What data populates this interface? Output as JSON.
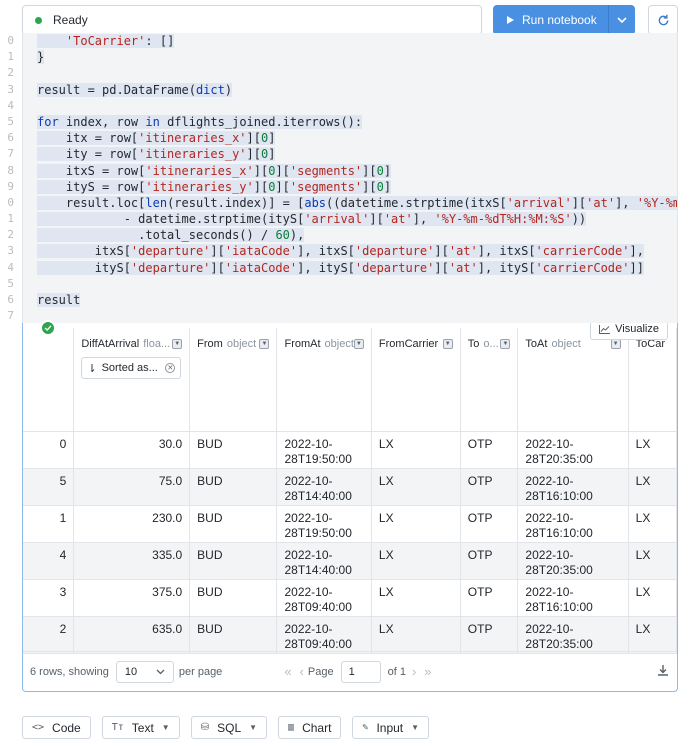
{
  "status": {
    "label": "Ready"
  },
  "run_button": {
    "label": "Run notebook"
  },
  "code": {
    "line_numbers": [
      "0",
      "1",
      "2",
      "3",
      "4",
      "5",
      "6",
      "7",
      "8",
      "9",
      "0",
      "1",
      "2",
      "3",
      "4",
      "5",
      "6",
      "7"
    ]
  },
  "output": {
    "visualize_label": "Visualize",
    "columns": [
      {
        "name": "",
        "type": ""
      },
      {
        "name": "DiffAtArrival",
        "type": "floa..."
      },
      {
        "name": "From",
        "type": "object"
      },
      {
        "name": "FromAt",
        "type": "object"
      },
      {
        "name": "FromCarrier",
        "type": ""
      },
      {
        "name": "To",
        "type": "o..."
      },
      {
        "name": "ToAt",
        "type": "object"
      },
      {
        "name": "ToCar",
        "type": ""
      }
    ],
    "sort_chip": "Sorted as...",
    "rows": [
      [
        "0",
        "30.0",
        "BUD",
        "2022-10-28T19:50:00",
        "LX",
        "OTP",
        "2022-10-28T20:35:00",
        "LX"
      ],
      [
        "5",
        "75.0",
        "BUD",
        "2022-10-28T14:40:00",
        "LX",
        "OTP",
        "2022-10-28T16:10:00",
        "LX"
      ],
      [
        "1",
        "230.0",
        "BUD",
        "2022-10-28T19:50:00",
        "LX",
        "OTP",
        "2022-10-28T16:10:00",
        "LX"
      ],
      [
        "4",
        "335.0",
        "BUD",
        "2022-10-28T14:40:00",
        "LX",
        "OTP",
        "2022-10-28T20:35:00",
        "LX"
      ],
      [
        "3",
        "375.0",
        "BUD",
        "2022-10-28T09:40:00",
        "LX",
        "OTP",
        "2022-10-28T16:10:00",
        "LX"
      ],
      [
        "2",
        "635.0",
        "BUD",
        "2022-10-28T09:40:00",
        "LX",
        "OTP",
        "2022-10-28T20:35:00",
        "LX"
      ]
    ],
    "pager": {
      "rows_label": "6 rows, showing",
      "per_page_value": "10",
      "per_page_label": "per page",
      "page_label": "Page",
      "page_value": "1",
      "of_label": "of 1"
    }
  },
  "toolbar": {
    "code": "Code",
    "text": "Text",
    "sql": "SQL",
    "chart": "Chart",
    "input": "Input"
  },
  "colors": {
    "accent": "#4a90e2",
    "ready": "#2da44e"
  }
}
